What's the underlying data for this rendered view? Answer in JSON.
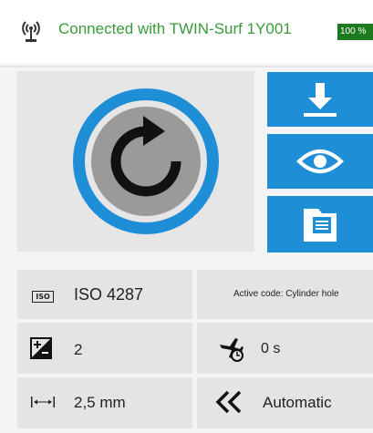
{
  "header": {
    "connection_text": "Connected with TWIN-Surf 1Y001",
    "battery_text": "100 %",
    "status_color": "#3a9a3a",
    "battery_color": "#1e7a1e"
  },
  "icons": {
    "antenna": "antenna-icon",
    "refresh": "refresh-icon",
    "download": "download-icon",
    "view": "eye-icon",
    "folder": "folder-icon",
    "iso_badge": "ISO",
    "plusminus": "plus-minus-icon",
    "timer": "airplane-timer-icon",
    "measure": "measure-length-icon",
    "rewind": "double-chevron-left-icon"
  },
  "colors": {
    "accent": "#1e8fd6",
    "refresh_ring": "#1e8fd6",
    "refresh_core": "#9a9a9a"
  },
  "settings": {
    "standard": "ISO 4287",
    "active_code": "Active code: Cylinder hole",
    "count": "2",
    "delay": "0 s",
    "length": "2,5 mm",
    "mode": "Automatic"
  }
}
